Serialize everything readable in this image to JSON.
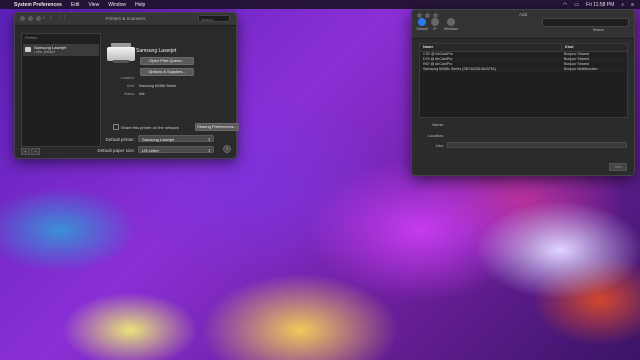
{
  "menubar": {
    "apple": "",
    "app_name": "System Preferences",
    "items": [
      "Edit",
      "View",
      "Window",
      "Help"
    ],
    "clock": "Fri 11:58 PM"
  },
  "printers_window": {
    "title": "Printers & Scanners",
    "search_placeholder": "Search",
    "list_header": "Printers",
    "printer_item": {
      "name": "Samsung Laserjet",
      "status": "• Idle, Default"
    },
    "add_remove": [
      "+",
      "−"
    ],
    "selected_name": "Samsung Laserjet",
    "open_queue_label": "Open Print Queue...",
    "options_label": "Options & Supplies...",
    "info": [
      {
        "label": "Location:",
        "value": ""
      },
      {
        "label": "Kind:",
        "value": "Samsung M288x Series"
      },
      {
        "label": "Status:",
        "value": "Idle"
      }
    ],
    "share_label": "Share this printer on the network",
    "sharing_prefs_label": "Sharing Preferences...",
    "default_printer_label": "Default printer:",
    "default_printer_value": "Samsung Laserjet",
    "paper_size_label": "Default paper size:",
    "paper_size_value": "US Letter",
    "help": "?"
  },
  "add_window": {
    "title": "Add",
    "tabs": [
      {
        "label": "Default",
        "icon": "printer-icon"
      },
      {
        "label": "IP",
        "icon": "globe-icon"
      },
      {
        "label": "Windows",
        "icon": "windows-icon"
      }
    ],
    "search_label": "Search",
    "columns": [
      "Name",
      "Kind"
    ],
    "rows": [
      {
        "name": "CS2 @ AirCastPro",
        "kind": "Bonjour Shared"
      },
      {
        "name": "D75 @ AirCastPro",
        "kind": "Bonjour Shared"
      },
      {
        "name": "R67 @ AirCastPro",
        "kind": "Bonjour Shared"
      },
      {
        "name": "Samsung M288x Series (SEC842519643751)",
        "kind": "Bonjour Multifunction"
      }
    ],
    "name_label": "Name:",
    "location_label": "Location:",
    "use_label": "Use:",
    "add_button": "Add"
  }
}
